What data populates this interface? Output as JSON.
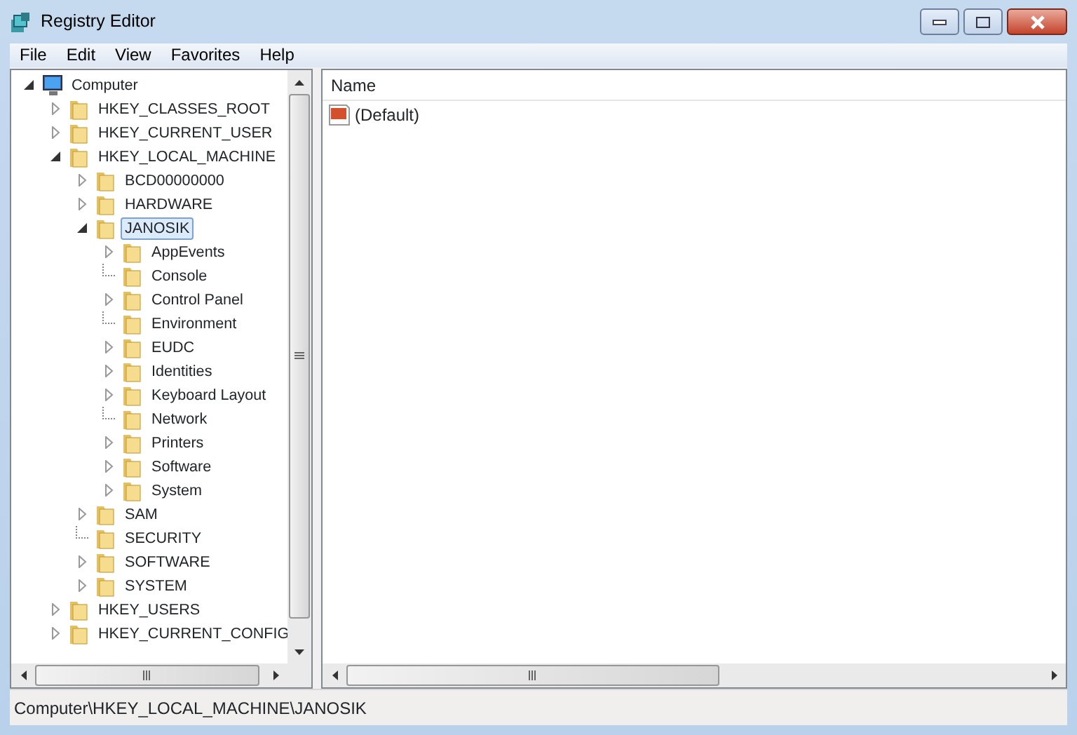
{
  "window": {
    "title": "Registry Editor"
  },
  "menu": [
    "File",
    "Edit",
    "View",
    "Favorites",
    "Help"
  ],
  "tree": [
    {
      "label": "Computer",
      "kind": "computer",
      "expandable": true,
      "expanded": true,
      "selected": false,
      "children": [
        {
          "label": "HKEY_CLASSES_ROOT",
          "kind": "folder",
          "expandable": true,
          "expanded": false,
          "selected": false
        },
        {
          "label": "HKEY_CURRENT_USER",
          "kind": "folder",
          "expandable": true,
          "expanded": false,
          "selected": false
        },
        {
          "label": "HKEY_LOCAL_MACHINE",
          "kind": "folder",
          "expandable": true,
          "expanded": true,
          "selected": false,
          "children": [
            {
              "label": "BCD00000000",
              "kind": "folder",
              "expandable": true,
              "expanded": false,
              "selected": false
            },
            {
              "label": "HARDWARE",
              "kind": "folder",
              "expandable": true,
              "expanded": false,
              "selected": false
            },
            {
              "label": "JANOSIK",
              "kind": "folder",
              "expandable": true,
              "expanded": true,
              "selected": true,
              "children": [
                {
                  "label": "AppEvents",
                  "kind": "folder",
                  "expandable": true,
                  "expanded": false,
                  "selected": false
                },
                {
                  "label": "Console",
                  "kind": "folder",
                  "expandable": false,
                  "selected": false
                },
                {
                  "label": "Control Panel",
                  "kind": "folder",
                  "expandable": true,
                  "expanded": false,
                  "selected": false
                },
                {
                  "label": "Environment",
                  "kind": "folder",
                  "expandable": false,
                  "selected": false
                },
                {
                  "label": "EUDC",
                  "kind": "folder",
                  "expandable": true,
                  "expanded": false,
                  "selected": false
                },
                {
                  "label": "Identities",
                  "kind": "folder",
                  "expandable": true,
                  "expanded": false,
                  "selected": false
                },
                {
                  "label": "Keyboard Layout",
                  "kind": "folder",
                  "expandable": true,
                  "expanded": false,
                  "selected": false
                },
                {
                  "label": "Network",
                  "kind": "folder",
                  "expandable": false,
                  "selected": false
                },
                {
                  "label": "Printers",
                  "kind": "folder",
                  "expandable": true,
                  "expanded": false,
                  "selected": false
                },
                {
                  "label": "Software",
                  "kind": "folder",
                  "expandable": true,
                  "expanded": false,
                  "selected": false
                },
                {
                  "label": "System",
                  "kind": "folder",
                  "expandable": true,
                  "expanded": false,
                  "selected": false
                }
              ]
            },
            {
              "label": "SAM",
              "kind": "folder",
              "expandable": true,
              "expanded": false,
              "selected": false
            },
            {
              "label": "SECURITY",
              "kind": "folder",
              "expandable": false,
              "selected": false
            },
            {
              "label": "SOFTWARE",
              "kind": "folder",
              "expandable": true,
              "expanded": false,
              "selected": false
            },
            {
              "label": "SYSTEM",
              "kind": "folder",
              "expandable": true,
              "expanded": false,
              "selected": false
            }
          ]
        },
        {
          "label": "HKEY_USERS",
          "kind": "folder",
          "expandable": true,
          "expanded": false,
          "selected": false
        },
        {
          "label": "HKEY_CURRENT_CONFIG",
          "kind": "folder",
          "expandable": true,
          "expanded": false,
          "selected": false
        }
      ]
    }
  ],
  "list": {
    "columns": [
      "Name"
    ],
    "rows": [
      {
        "name": "(Default)"
      }
    ]
  },
  "status_bar": "Computer\\HKEY_LOCAL_MACHINE\\JANOSIK"
}
